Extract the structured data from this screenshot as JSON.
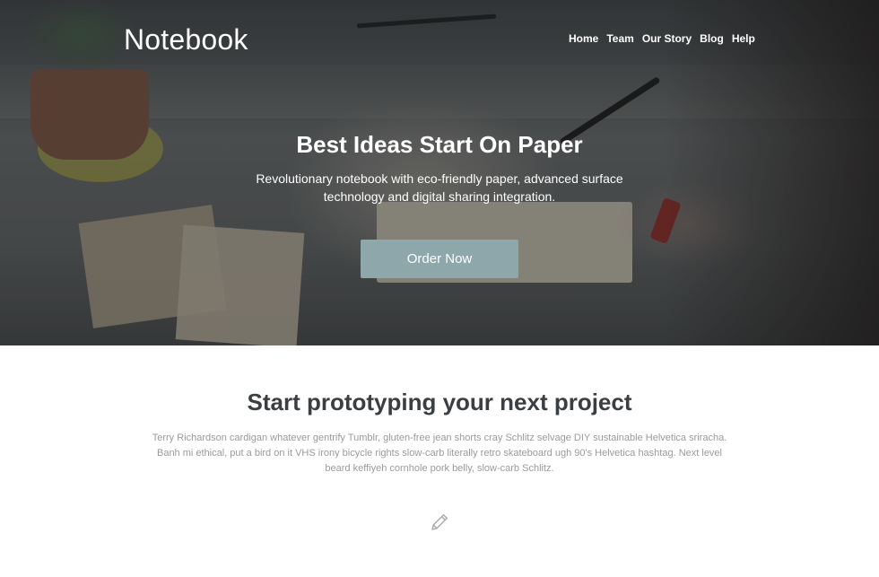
{
  "header": {
    "brand": "Notebook",
    "nav": [
      "Home",
      "Team",
      "Our Story",
      "Blog",
      "Help"
    ]
  },
  "hero": {
    "title": "Best Ideas Start On Paper",
    "subtitle": "Revolutionary notebook with eco-friendly paper, advanced surface technology and digital sharing integration.",
    "cta_label": "Order Now",
    "cta_color": "#8ea7ab"
  },
  "feature": {
    "title": "Start prototyping your next project",
    "text": "Terry Richardson cardigan whatever gentrify Tumblr, gluten-free jean shorts cray Schlitz selvage DIY sustainable Helvetica sriracha. Banh mi ethical, put a bird on it VHS irony bicycle rights slow-carb literally retro skateboard ugh 90's Helvetica hashtag. Next level beard keffiyeh cornhole pork belly, slow-carb Schlitz.",
    "icon": "pencil-icon"
  },
  "colors": {
    "heading_text": "#3b3f42",
    "body_text": "#9a9a9a"
  }
}
